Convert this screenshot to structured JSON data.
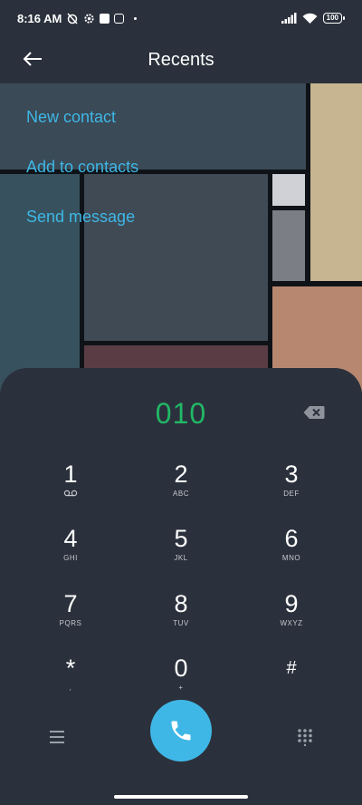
{
  "status_bar": {
    "time": "8:16 AM",
    "battery": "100",
    "icons": [
      "alarm-off-icon",
      "settings-icon",
      "square-icon",
      "mi-badge-icon",
      "dot-icon",
      "signal-icon",
      "wifi-icon",
      "battery-icon"
    ]
  },
  "header": {
    "title": "Recents",
    "back_icon": "arrow-left-icon"
  },
  "menu": {
    "items": [
      {
        "label": "New contact"
      },
      {
        "label": "Add to contacts"
      },
      {
        "label": "Send message"
      }
    ]
  },
  "dialer": {
    "number": "010",
    "backspace_icon": "backspace-icon",
    "keys": [
      {
        "digit": "1",
        "sub": "voicemail-icon"
      },
      {
        "digit": "2",
        "sub": "ABC"
      },
      {
        "digit": "3",
        "sub": "DEF"
      },
      {
        "digit": "4",
        "sub": "GHI"
      },
      {
        "digit": "5",
        "sub": "JKL"
      },
      {
        "digit": "6",
        "sub": "MNO"
      },
      {
        "digit": "7",
        "sub": "PQRS"
      },
      {
        "digit": "8",
        "sub": "TUV"
      },
      {
        "digit": "9",
        "sub": "WXYZ"
      },
      {
        "digit": "*",
        "sub": ","
      },
      {
        "digit": "0",
        "sub": "+"
      },
      {
        "digit": "#",
        "sub": ""
      }
    ]
  },
  "bottom_bar": {
    "menu_icon": "hamburger-menu-icon",
    "call_icon": "phone-icon",
    "keypad_icon": "keypad-grid-icon"
  },
  "colors": {
    "background": "#2b313c",
    "accent_blue": "#3fb7e6",
    "number_green": "#21b866"
  }
}
